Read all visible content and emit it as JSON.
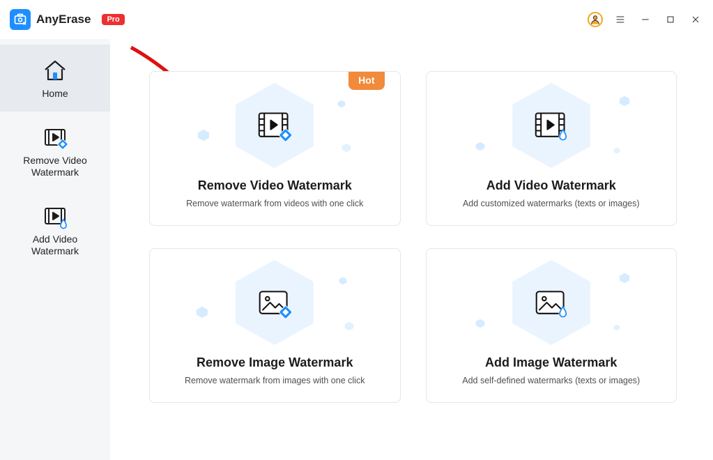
{
  "app": {
    "name": "AnyErase",
    "badge": "Pro"
  },
  "sidebar": [
    {
      "key": "home",
      "label": "Home",
      "active": true
    },
    {
      "key": "remove-video",
      "label": "Remove Video\nWatermark",
      "active": false
    },
    {
      "key": "add-video",
      "label": "Add Video\nWatermark",
      "active": false
    }
  ],
  "hot_label": "Hot",
  "cards": [
    {
      "key": "remove-video",
      "title": "Remove Video Watermark",
      "subtitle": "Remove watermark from videos with one click",
      "hot": true,
      "icon": "video-erase"
    },
    {
      "key": "add-video",
      "title": "Add Video Watermark",
      "subtitle": "Add customized watermarks (texts or images)",
      "hot": false,
      "icon": "video-drop"
    },
    {
      "key": "remove-image",
      "title": "Remove Image Watermark",
      "subtitle": "Remove watermark from images with one click",
      "hot": false,
      "icon": "image-erase"
    },
    {
      "key": "add-image",
      "title": "Add Image Watermark",
      "subtitle": "Add self-defined watermarks  (texts or images)",
      "hot": false,
      "icon": "image-drop"
    }
  ],
  "colors": {
    "accent": "#1f8fff",
    "hot": "#f28a3b",
    "pro": "#ee3030",
    "ring": "#f5a623"
  }
}
